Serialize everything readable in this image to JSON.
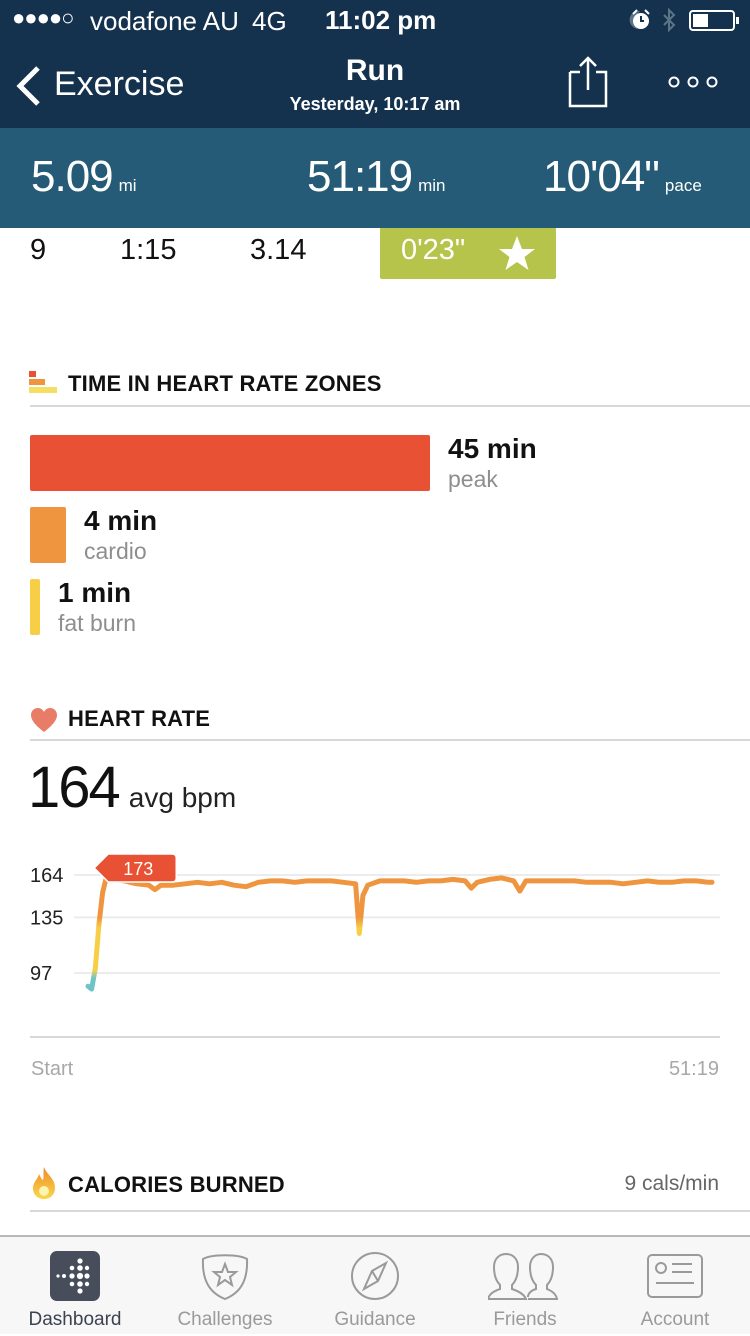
{
  "status_bar": {
    "signal": "●●●●○",
    "carrier": "vodafone AU",
    "network": "4G",
    "time": "11:02 pm",
    "icons": [
      "moon-icon",
      "alarm-icon",
      "bluetooth-icon",
      "battery-icon"
    ],
    "battery_level": 0.35
  },
  "nav": {
    "back_label": "Exercise",
    "title": "Run",
    "subtitle": "Yesterday, 10:17 am",
    "share_icon": "share-icon",
    "more_icon": "more-icon"
  },
  "summary": {
    "distance": "5.09",
    "distance_unit": "mi",
    "duration": "51:19",
    "duration_unit": "min",
    "pace": "10'04\"",
    "pace_unit": "pace"
  },
  "split_row": {
    "index": "9",
    "time": "1:15",
    "distance": "3.14",
    "delta": "0'23\"",
    "badge_icon": "star-icon"
  },
  "zones": {
    "title": "TIME IN HEART RATE ZONES",
    "items": [
      {
        "value": "45 min",
        "label": "peak",
        "minutes": 45,
        "color": "#e85133"
      },
      {
        "value": "4 min",
        "label": "cardio",
        "minutes": 4,
        "color": "#ef953f"
      },
      {
        "value": "1 min",
        "label": "fat burn",
        "minutes": 1,
        "color": "#f6cf47"
      }
    ]
  },
  "heart_rate": {
    "title": "HEART RATE",
    "avg_value": "164",
    "avg_unit": "avg bpm",
    "x_start": "Start",
    "x_end": "51:19"
  },
  "calories": {
    "title": "CALORIES BURNED",
    "rate": "9 cals/min"
  },
  "tabs": [
    {
      "label": "Dashboard",
      "icon": "dashboard-icon",
      "active": true
    },
    {
      "label": "Challenges",
      "icon": "challenges-icon",
      "active": false
    },
    {
      "label": "Guidance",
      "icon": "compass-icon",
      "active": false
    },
    {
      "label": "Friends",
      "icon": "friends-icon",
      "active": false
    },
    {
      "label": "Account",
      "icon": "account-icon",
      "active": false
    }
  ],
  "colors": {
    "nav_bg": "#14324d",
    "summary_bg": "#255b77",
    "badge_bg": "#b7c44c",
    "peak": "#e85133",
    "cardio": "#ef953f",
    "fatburn": "#f6cf47",
    "rest": "#6fc4c8"
  },
  "chart_data": {
    "type": "line",
    "title": "Heart Rate",
    "xlabel": "",
    "ylabel": "bpm",
    "x_range_min": [
      0,
      51.3
    ],
    "x_tick_labels": [
      "Start",
      "51:19"
    ],
    "y_ticks": [
      97,
      135,
      164
    ],
    "ylim": [
      75,
      175
    ],
    "grid": true,
    "peak_annotation": {
      "label": "173",
      "x_min": 1.5,
      "y": 173
    },
    "series": [
      {
        "name": "heart rate",
        "x_min": [
          0,
          0.3,
          0.6,
          0.9,
          1.2,
          1.5,
          2,
          3,
          4,
          5,
          5.5,
          6,
          7,
          8,
          9,
          10,
          11,
          12,
          13,
          14,
          15,
          16,
          17,
          18,
          19,
          20,
          21,
          22,
          22.3,
          22.6,
          23,
          24,
          25,
          26,
          27,
          28,
          29,
          30,
          31,
          31.5,
          32,
          33,
          34,
          35,
          35.5,
          36,
          37,
          38,
          39,
          40,
          41,
          42,
          43,
          44,
          45,
          46,
          47,
          48,
          49,
          50,
          51,
          51.3
        ],
        "bpm": [
          88,
          86,
          100,
          130,
          152,
          162,
          161,
          160,
          158,
          157,
          154,
          157,
          157,
          158,
          159,
          158,
          159,
          157,
          156,
          159,
          160,
          160,
          159,
          160,
          160,
          160,
          159,
          158,
          124,
          150,
          157,
          160,
          160,
          160,
          159,
          160,
          160,
          161,
          160,
          155,
          159,
          161,
          162,
          160,
          153,
          160,
          160,
          160,
          160,
          160,
          159,
          159,
          159,
          158,
          159,
          160,
          159,
          159,
          160,
          160,
          159,
          159
        ]
      }
    ]
  }
}
